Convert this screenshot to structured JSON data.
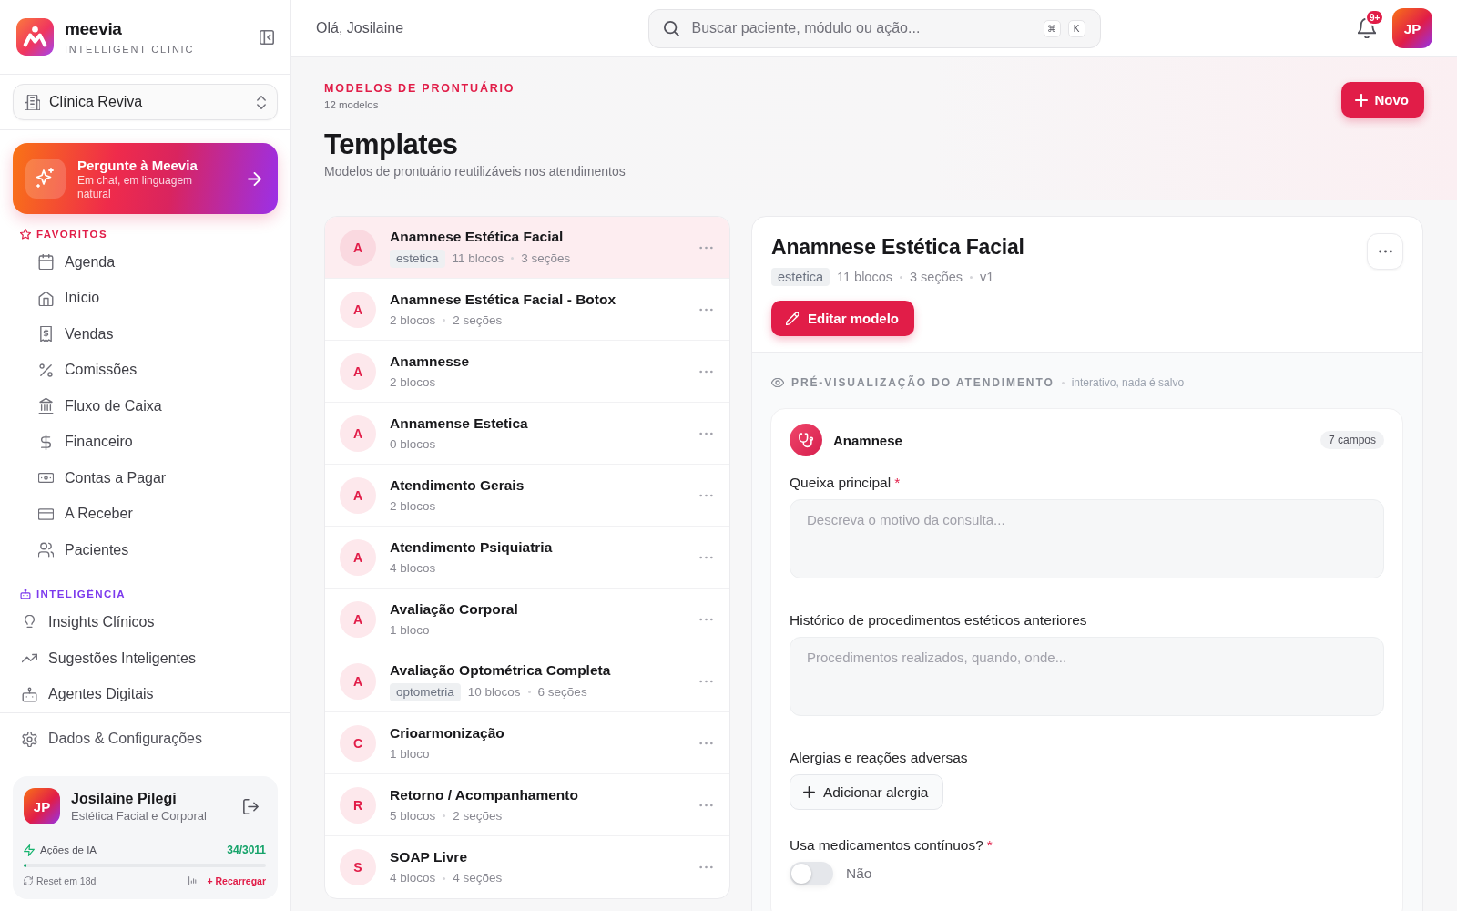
{
  "sidebar": {
    "brand": {
      "name": "meevia",
      "tagline": "INTELLIGENT CLINIC"
    },
    "clinic_selector": {
      "value": "Clínica Reviva"
    },
    "assistant": {
      "title": "Pergunte à Meevia",
      "subtitle": "Em chat, em linguagem natural"
    },
    "sections": [
      {
        "kind": "favorites",
        "title": "FAVORITOS",
        "items": [
          "Agenda",
          "Início",
          "Vendas",
          "Comissões",
          "Fluxo de Caixa",
          "Financeiro",
          "Contas a Pagar",
          "A Receber",
          "Pacientes"
        ]
      },
      {
        "kind": "intelligence",
        "title": "INTELIGÊNCIA",
        "items": [
          "Insights Clínicos",
          "Sugestões Inteligentes",
          "Agentes Digitais"
        ]
      }
    ],
    "settings_item": "Dados & Configurações",
    "user_card": {
      "avatar": "JP",
      "name": "Josilaine Pilegi",
      "role": "Estética Facial e Corporal",
      "ai_usage": {
        "label": "Ações de IA",
        "reading": "34/3011",
        "level": 0.011
      },
      "reset": "Reset em 18d",
      "recharge": "+ Recarregar"
    }
  },
  "top_bar": {
    "greeting": "Olá, Josilaine",
    "search": {
      "placeholder": "Buscar paciente, módulo ou ação...",
      "shortcut": [
        "⌘",
        "K"
      ]
    },
    "notifications": {
      "badge": "9+"
    },
    "avatar": "JP"
  },
  "page_header": {
    "eyebrow": "MODELOS DE PRONTUÁRIO",
    "count": "12 modelos",
    "title": "Templates",
    "subtitle": "Modelos de prontuário reutilizáveis nos atendimentos",
    "new_button": "Novo"
  },
  "templates": [
    {
      "initial": "A",
      "name": "Anamnese Estética Facial",
      "tag": "estetica",
      "meta": [
        "11 blocos",
        "3 seções"
      ],
      "selected": true
    },
    {
      "initial": "A",
      "name": "Anamnese Estética Facial - Botox",
      "meta": [
        "2 blocos",
        "2 seções"
      ],
      "selected": false
    },
    {
      "initial": "A",
      "name": "Anamnesse",
      "meta": [
        "2 blocos"
      ],
      "selected": false
    },
    {
      "initial": "A",
      "name": "Annamense Estetica",
      "meta": [
        "0 blocos"
      ],
      "selected": false
    },
    {
      "initial": "A",
      "name": "Atendimento Gerais",
      "meta": [
        "2 blocos"
      ],
      "selected": false
    },
    {
      "initial": "A",
      "name": "Atendimento Psiquiatria",
      "meta": [
        "4 blocos"
      ],
      "selected": false
    },
    {
      "initial": "A",
      "name": "Avaliação Corporal",
      "meta": [
        "1 bloco"
      ],
      "selected": false
    },
    {
      "initial": "A",
      "name": "Avaliação Optométrica Completa",
      "tag": "optometria",
      "meta": [
        "10 blocos",
        "6 seções"
      ],
      "selected": false
    },
    {
      "initial": "C",
      "name": "Crioarmonização",
      "meta": [
        "1 bloco"
      ],
      "selected": false
    },
    {
      "initial": "R",
      "name": "Retorno / Acompanhamento",
      "meta": [
        "5 blocos",
        "2 seções"
      ],
      "selected": false
    },
    {
      "initial": "S",
      "name": "SOAP Livre",
      "meta": [
        "4 blocos",
        "4 seções"
      ],
      "selected": false
    }
  ],
  "detail": {
    "title": "Anamnese Estética Facial",
    "tag": "estetica",
    "meta": [
      "11 blocos",
      "3 seções",
      "v1"
    ],
    "edit_button": "Editar modelo",
    "preview": {
      "title": "PRÉ-VISUALIZAÇÃO DO ATENDIMENTO",
      "note": "interativo, nada é salvo",
      "section": {
        "title": "Anamnese",
        "count": "7 campos",
        "fields": [
          {
            "kind": "textarea",
            "label": "Queixa principal",
            "required_mark": "*",
            "placeholder": "Descreva o motivo da consulta..."
          },
          {
            "kind": "textarea",
            "label": "Histórico de procedimentos estéticos anteriores",
            "placeholder": "Procedimentos realizados, quando, onde..."
          },
          {
            "kind": "list",
            "label": "Alergias e reações adversas",
            "button": "Adicionar alergia"
          },
          {
            "kind": "toggle",
            "label": "Usa medicamentos contínuos?",
            "required_mark": "*",
            "on": false,
            "value": "Não"
          }
        ]
      }
    }
  }
}
